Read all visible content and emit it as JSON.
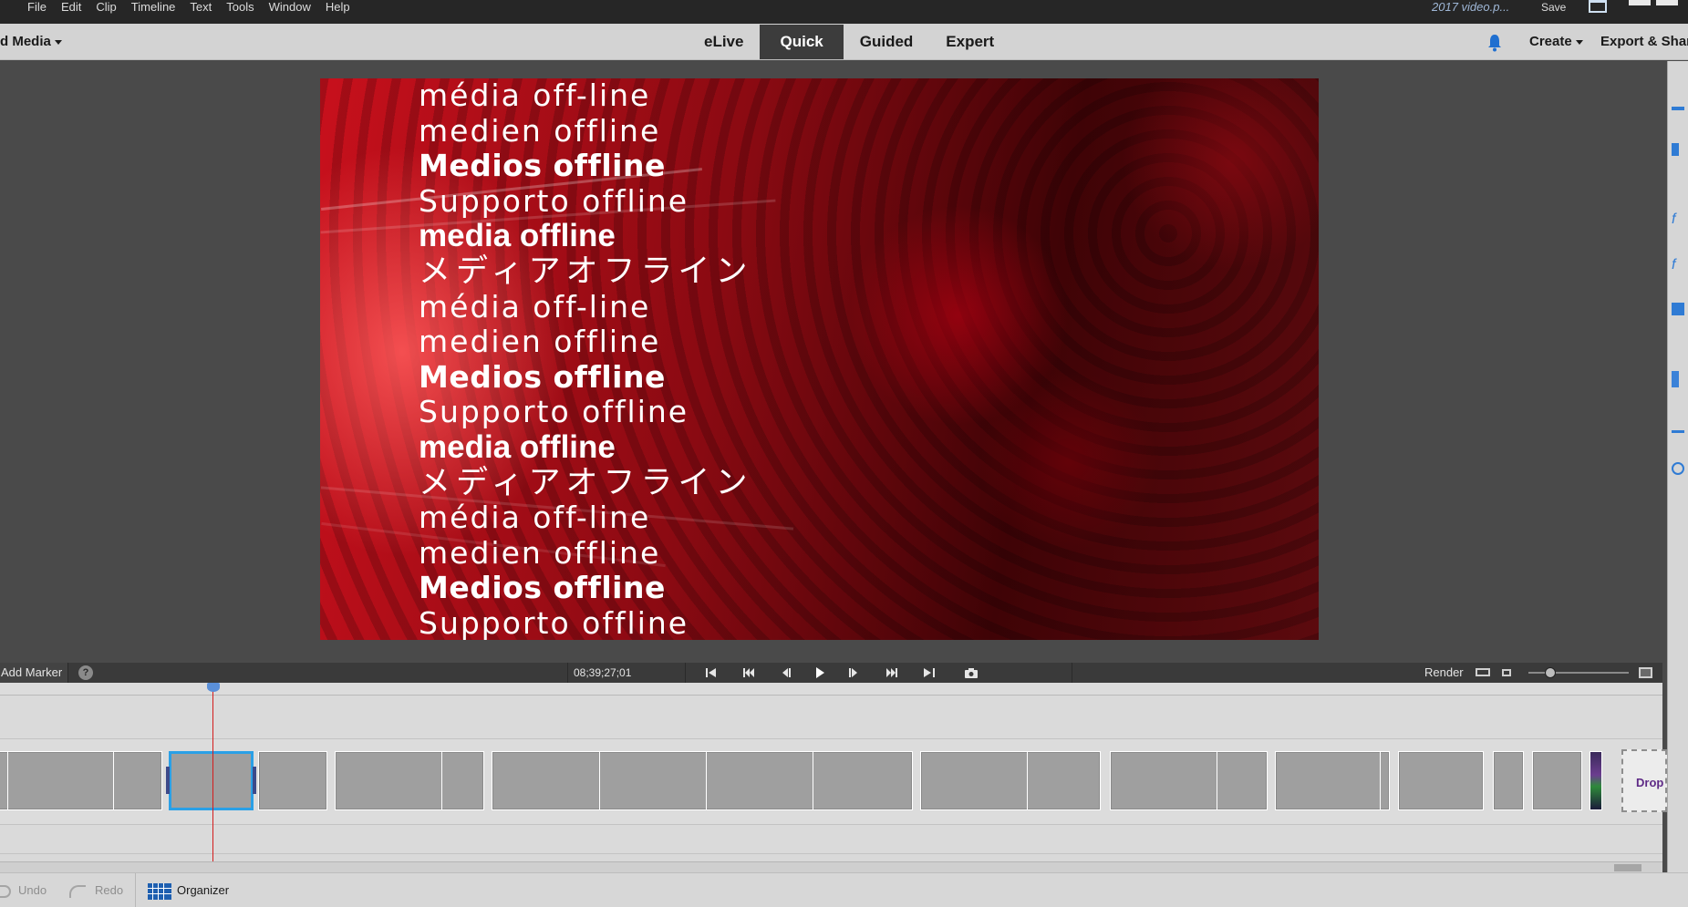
{
  "menubar": {
    "items": [
      "File",
      "Edit",
      "Clip",
      "Timeline",
      "Text",
      "Tools",
      "Window",
      "Help"
    ],
    "file_title": "2017 video.p...",
    "save_label": "Save"
  },
  "topnav": {
    "add_media_label": "d Media",
    "tabs": [
      {
        "label": "eLive",
        "active": false
      },
      {
        "label": "Quick",
        "active": true
      },
      {
        "label": "Guided",
        "active": false
      },
      {
        "label": "Expert",
        "active": false
      }
    ],
    "create_label": "Create",
    "export_label": "Export & Shar"
  },
  "monitor": {
    "offline_lines": [
      "média off-line",
      "medien offline",
      "Medios offline",
      "Supporto offline",
      "media offline",
      "メディアオフライン",
      "média off-line",
      "medien offline",
      "Medios offline",
      "Supporto offline",
      "media offline",
      "メディアオフライン",
      "média off-line",
      "medien offline",
      "Medios offline",
      "Supporto offline"
    ]
  },
  "timeline_toolbar": {
    "add_marker_label": "Add Marker",
    "help_label": "?",
    "timecode": "08;39;27;01",
    "render_label": "Render"
  },
  "timeline": {
    "drop_label": "Drop"
  },
  "bottombar": {
    "undo_label": "Undo",
    "redo_label": "Redo",
    "organizer_label": "Organizer"
  },
  "colors": {
    "accent_blue": "#2aa0e6",
    "playhead_red": "#d41c1c",
    "active_tab_bg": "#3c3c3c"
  }
}
